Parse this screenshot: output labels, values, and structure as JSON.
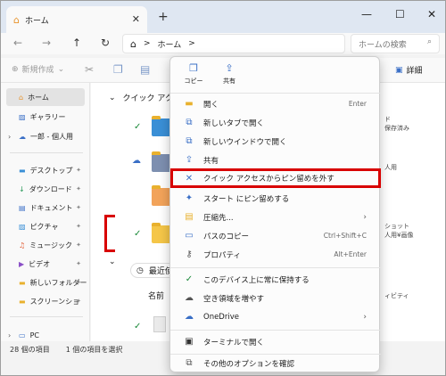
{
  "tab": {
    "title": "ホーム",
    "close": "✕",
    "new": "+"
  },
  "window_buttons": {
    "minimize": "—",
    "maximize": "☐",
    "close": "✕"
  },
  "nav": {
    "back": "←",
    "forward": "→",
    "up": "↑",
    "refresh": "↻"
  },
  "address": {
    "sep1": ">",
    "location": "ホーム",
    "sep2": ">"
  },
  "search": {
    "placeholder": "ホームの検索"
  },
  "toolbar": {
    "new_label": "新規作成",
    "details_label": "詳細"
  },
  "sidebar": {
    "items": [
      {
        "label": "ホーム",
        "pinned": false
      },
      {
        "label": "ギャラリー",
        "pinned": false
      },
      {
        "label": "一郎 - 個人用",
        "pinned": false
      },
      {
        "label": "デスクトップ",
        "pinned": true
      },
      {
        "label": "ダウンロード",
        "pinned": true
      },
      {
        "label": "ドキュメント",
        "pinned": true
      },
      {
        "label": "ピクチャ",
        "pinned": true
      },
      {
        "label": "ミュージック",
        "pinned": true
      },
      {
        "label": "ビデオ",
        "pinned": true
      },
      {
        "label": "新しいフォルダー",
        "pinned": true
      },
      {
        "label": "スクリーンショ",
        "pinned": true
      },
      {
        "label": "PC",
        "pinned": false
      }
    ]
  },
  "content": {
    "quick_access_title": "クイック アク",
    "recent_title": "最近使",
    "name_header": "名前",
    "right_texts": [
      "ド",
      "保存済み",
      "人用",
      "ショット",
      "人用¥画像",
      "ィビティ"
    ]
  },
  "statusbar": {
    "count": "28 個の項目",
    "selected": "1 個の項目を選択"
  },
  "menu": {
    "quick_actions": [
      {
        "label": "コピー",
        "icon": "copy-icon"
      },
      {
        "label": "共有",
        "icon": "share-icon"
      }
    ],
    "items": [
      {
        "label": "開く",
        "shortcut": "Enter",
        "icon": "folder-icon"
      },
      {
        "label": "新しいタブで開く",
        "shortcut": "",
        "icon": "new-tab-icon"
      },
      {
        "label": "新しいウインドウで開く",
        "shortcut": "",
        "icon": "new-window-icon"
      },
      {
        "label": "共有",
        "shortcut": "",
        "icon": "share-icon"
      },
      {
        "label": "クイック アクセスからピン留めを外す",
        "shortcut": "",
        "icon": "unpin-icon"
      },
      {
        "label": "スタート にピン留めする",
        "shortcut": "",
        "icon": "pin-icon"
      },
      {
        "label": "圧縮先...",
        "shortcut": "",
        "icon": "zip-icon"
      },
      {
        "label": "パスのコピー",
        "shortcut": "Ctrl+Shift+C",
        "icon": "path-icon"
      },
      {
        "label": "プロパティ",
        "shortcut": "Alt+Enter",
        "icon": "properties-icon"
      },
      {
        "label": "このデバイス上に常に保持する",
        "shortcut": "",
        "icon": "keep-icon"
      },
      {
        "label": "空き領域を増やす",
        "shortcut": "",
        "icon": "cloud-icon"
      },
      {
        "label": "OneDrive",
        "shortcut": "",
        "icon": "onedrive-icon"
      },
      {
        "label": "ターミナルで開く",
        "shortcut": "",
        "icon": "terminal-icon"
      },
      {
        "label": "その他のオプションを確認",
        "shortcut": "",
        "icon": "more-options-icon"
      }
    ]
  },
  "colors": {
    "highlight": "#d80000",
    "folder": "#f5c648",
    "accent": "#3a6fc6"
  }
}
